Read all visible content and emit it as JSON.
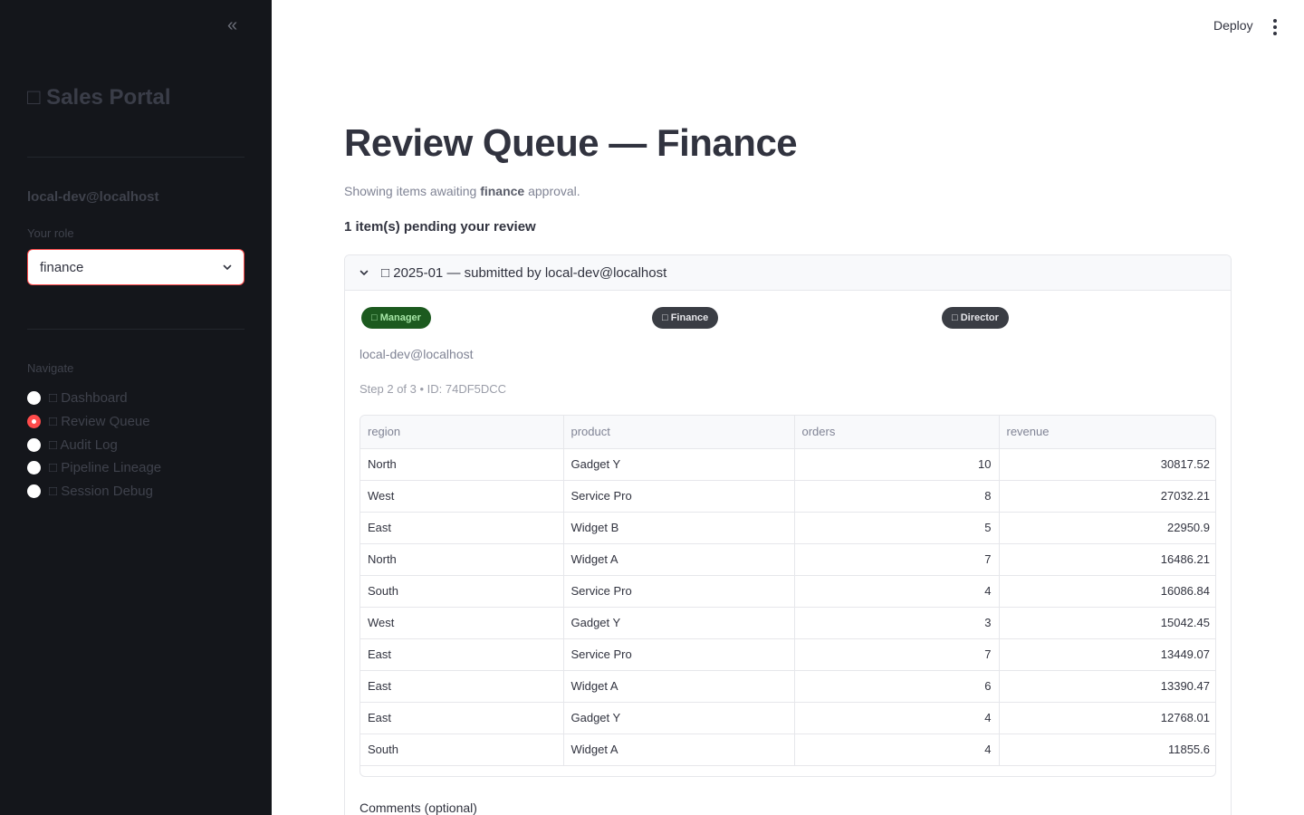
{
  "sidebar": {
    "collapse_glyph": "«",
    "app_title": "□ Sales Portal",
    "user_email": "local-dev@localhost",
    "role_label": "Your role",
    "role_value": "finance",
    "nav_label": "Navigate",
    "nav_items": [
      {
        "label": "□ Dashboard",
        "selected": false
      },
      {
        "label": "□ Review Queue",
        "selected": true
      },
      {
        "label": "□ Audit Log",
        "selected": false
      },
      {
        "label": "□ Pipeline Lineage",
        "selected": false
      },
      {
        "label": "□ Session Debug",
        "selected": false
      }
    ]
  },
  "header": {
    "deploy_label": "Deploy",
    "menu_icon": "kebab-menu-icon"
  },
  "main": {
    "title": "Review Queue — Finance",
    "caption_prefix": "Showing items awaiting ",
    "caption_bold": "finance",
    "caption_suffix": " approval.",
    "pending_text": "1 item(s) pending your review",
    "expander": {
      "title": "□ 2025-01 — submitted by local-dev@localhost",
      "badges": [
        {
          "label": "□ Manager",
          "color": "#1c5a1f"
        },
        {
          "label": "□ Finance",
          "color": "#3a3d44"
        },
        {
          "label": "□ Director",
          "color": "#3a3d44"
        }
      ],
      "submitter": "local-dev@localhost",
      "step": "Step 2 of 3 • ID: 74DF5DCC",
      "table": {
        "columns": [
          "region",
          "product",
          "orders",
          "revenue"
        ],
        "rows": [
          [
            "North",
            "Gadget Y",
            "10",
            "30817.52"
          ],
          [
            "West",
            "Service Pro",
            "8",
            "27032.21"
          ],
          [
            "East",
            "Widget B",
            "5",
            "22950.9"
          ],
          [
            "North",
            "Widget A",
            "7",
            "16486.21"
          ],
          [
            "South",
            "Service Pro",
            "4",
            "16086.84"
          ],
          [
            "West",
            "Gadget Y",
            "3",
            "15042.45"
          ],
          [
            "East",
            "Service Pro",
            "7",
            "13449.07"
          ],
          [
            "East",
            "Widget A",
            "6",
            "13390.47"
          ],
          [
            "East",
            "Gadget Y",
            "4",
            "12768.01"
          ],
          [
            "South",
            "Widget A",
            "4",
            "11855.6"
          ]
        ]
      },
      "comments_label": "Comments (optional)"
    }
  },
  "colors": {
    "sidebar_bg": "#14161b",
    "accent": "#ff4b4b",
    "approved_badge": "#1c5a1f",
    "pending_badge": "#3a3d44"
  }
}
